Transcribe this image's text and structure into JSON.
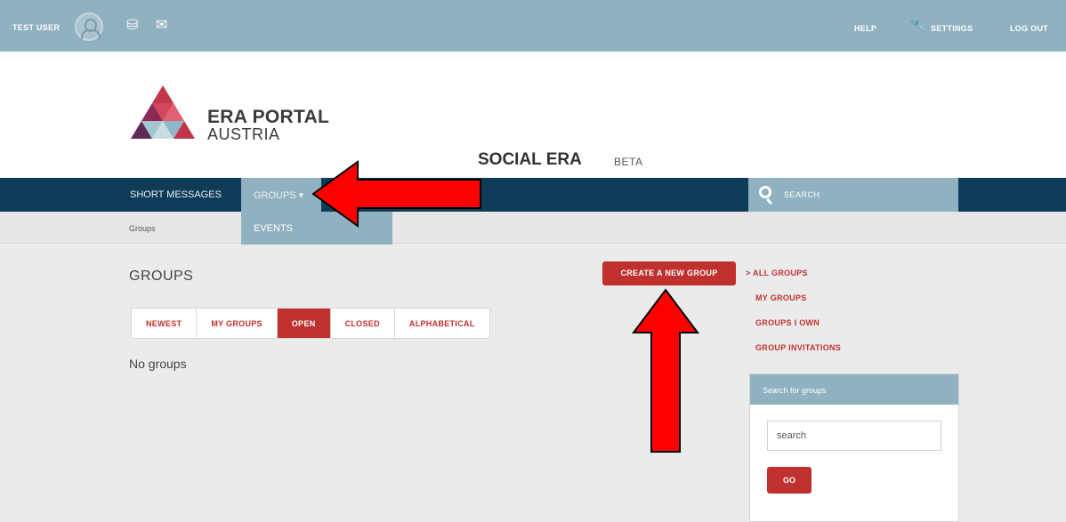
{
  "topbar": {
    "user": "TEST USER",
    "help": "HELP",
    "settings": "SETTINGS",
    "logout": "LOG OUT"
  },
  "header": {
    "brand_line1": "ERA PORTAL",
    "brand_line2": "AUSTRIA",
    "site_name": "SOCIAL ERA",
    "badge": "BETA"
  },
  "nav": {
    "short_messages": "SHORT MESSAGES",
    "groups": "GROUPS ▾",
    "events": "EVENTS",
    "search": "SEARCH"
  },
  "breadcrumb": "Groups",
  "main": {
    "title": "GROUPS",
    "tabs": [
      {
        "label": "NEWEST",
        "active": false
      },
      {
        "label": "MY GROUPS",
        "active": false
      },
      {
        "label": "OPEN",
        "active": true
      },
      {
        "label": "CLOSED",
        "active": false
      },
      {
        "label": "ALPHABETICAL",
        "active": false
      }
    ],
    "empty_text": "No groups",
    "create_button": "CREATE A NEW GROUP"
  },
  "sidebar": {
    "links": [
      {
        "label": "> ALL GROUPS"
      },
      {
        "label": "MY GROUPS"
      },
      {
        "label": "GROUPS I OWN"
      },
      {
        "label": "GROUP INVITATIONS"
      }
    ],
    "search_box": {
      "header": "Search for groups",
      "value": "search",
      "button": "GO"
    }
  },
  "colors": {
    "accent_red": "#c0302f",
    "nav_dark": "#0e3c58",
    "bar_blue": "#8fb1c0",
    "annotation_arrow": "#ff0000"
  },
  "icons": [
    "user-avatar-icon",
    "handshake-icon",
    "envelope-icon",
    "wrench-icon",
    "search-icon"
  ]
}
